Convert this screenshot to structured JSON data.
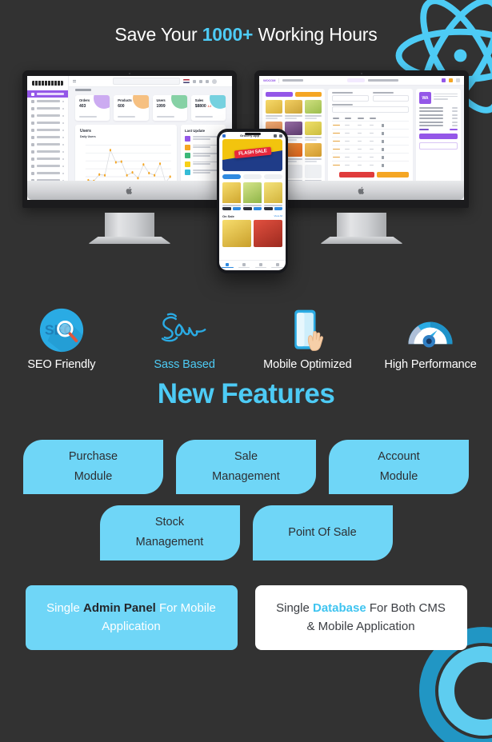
{
  "theme": {
    "background": "#323232",
    "accent": "#4dcbf5",
    "pill_bg": "#6fd6f7",
    "card_white": "#ffffff",
    "text_primary": "#ffffff",
    "text_dark": "#2d2f33"
  },
  "headline": {
    "before": "Save Your ",
    "accent": "1000+",
    "after": " Working Hours"
  },
  "mockups": {
    "left_monitor": {
      "type": "admin-dashboard",
      "logo": "KHOOL",
      "breadcrumb": "Dashboard",
      "search_placeholder": "Search",
      "stats": [
        {
          "title": "Orders",
          "value": "403",
          "blob": "#c9a7f0",
          "delta": ""
        },
        {
          "title": "Products",
          "value": "600",
          "blob": "#f5bd7a",
          "delta": ""
        },
        {
          "title": "Users",
          "value": "1999",
          "blob": "#7fcfa0",
          "delta": ""
        },
        {
          "title": "Sales",
          "value": "$8800",
          "blob": "#6fcfdd",
          "delta": "4.3"
        }
      ],
      "chart": {
        "title": "Users",
        "subtitle": "Daily Users"
      },
      "update_panel": {
        "title": "Last Update",
        "swatches": [
          "#9457e8",
          "#f5a623",
          "#3cb878",
          "#f7d117",
          "#35bcd6"
        ]
      }
    },
    "right_monitor": {
      "type": "point-of-sale",
      "logo": "WOCOM",
      "customer_initials": "WA",
      "customer_label": "Walk In Customer"
    },
    "phone": {
      "title": "Grocery App",
      "banner_text": "FLASH SALE",
      "section_title": "On Sale",
      "section_more": "View All"
    }
  },
  "features": [
    {
      "label": "SEO Friendly",
      "icon": "seo-icon",
      "accent": false
    },
    {
      "label": "Sass Based",
      "icon": "sass-icon",
      "accent": true
    },
    {
      "label": "Mobile Optimized",
      "icon": "mobile-icon",
      "accent": false
    },
    {
      "label": "High Performance",
      "icon": "speedometer-icon",
      "accent": false
    }
  ],
  "section": {
    "title": "New Features"
  },
  "pills": {
    "row1": [
      {
        "line1": "Purchase",
        "line2": "Module"
      },
      {
        "line1": "Sale",
        "line2": "Management"
      },
      {
        "line1": "Account",
        "line2": "Module"
      }
    ],
    "row2": [
      {
        "line1": "Stock",
        "line2": "Management"
      },
      {
        "line1": "Point Of Sale",
        "line2": ""
      }
    ]
  },
  "info_cards": [
    {
      "style": "blue",
      "before": "Single ",
      "strong": "Admin Panel",
      "after": " For Mobile Application"
    },
    {
      "style": "white",
      "before": "Single ",
      "strong": "Database",
      "after": " For Both CMS & Mobile Application"
    }
  ],
  "decor": {
    "react_logo": "react-atom-logo",
    "corner_rings": "concentric-rings"
  }
}
